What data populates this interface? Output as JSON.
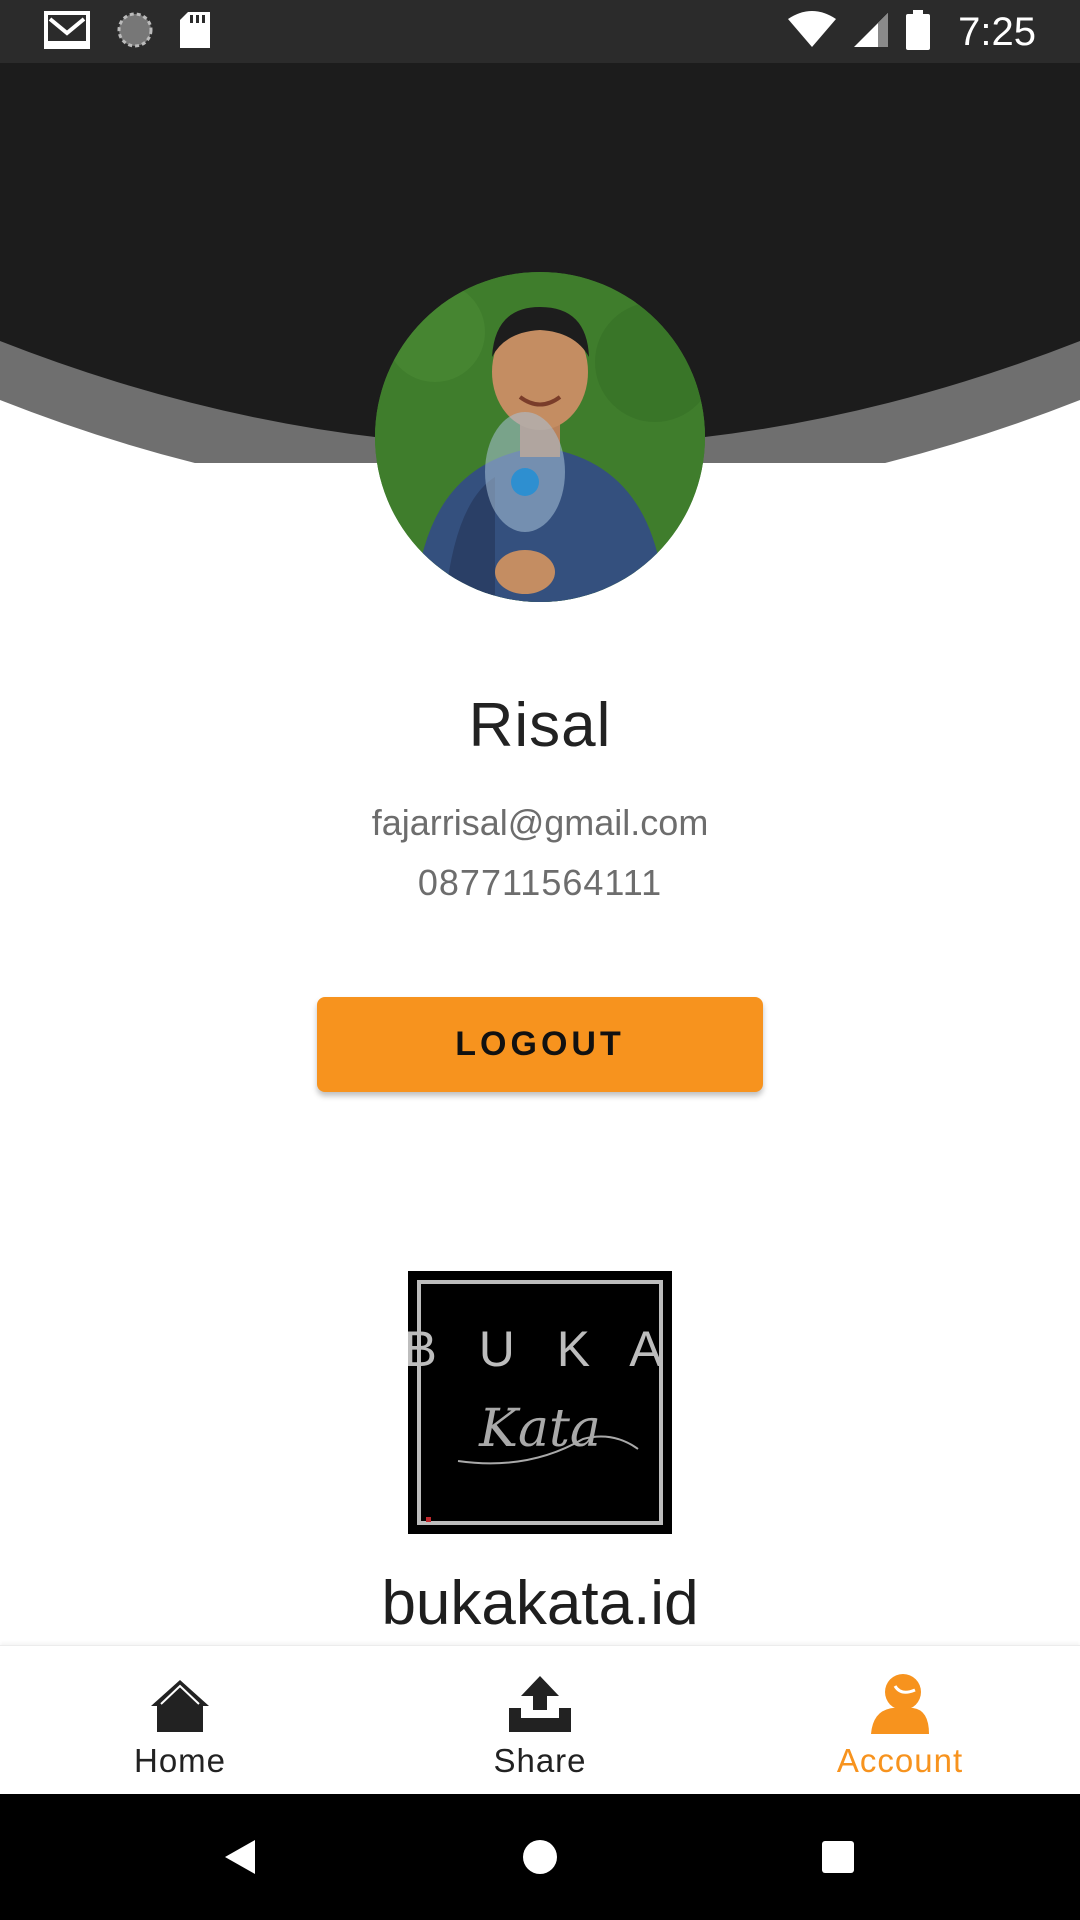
{
  "status_bar": {
    "time": "7:25",
    "left_icons": [
      "gmail-icon",
      "sync-icon",
      "sd-card-icon"
    ],
    "right_icons": [
      "wifi-icon",
      "cell-signal-icon",
      "battery-icon"
    ]
  },
  "profile": {
    "name": "Risal",
    "email": "fajarrisal@gmail.com",
    "phone": "087711564111",
    "logout_label": "LOGOUT"
  },
  "brand": {
    "logo_text_top": "B U K A",
    "logo_text_script": "Kata",
    "name": "bukakata.id"
  },
  "bottom_nav": {
    "items": [
      {
        "label": "Home",
        "icon": "home-icon",
        "active": false
      },
      {
        "label": "Share",
        "icon": "upload-icon",
        "active": false
      },
      {
        "label": "Account",
        "icon": "account-icon",
        "active": true
      }
    ]
  },
  "system_nav": {
    "buttons": [
      "back-icon",
      "home-circle-icon",
      "recents-icon"
    ]
  },
  "colors": {
    "accent": "#f7931e",
    "header_dark": "#1c1c1c",
    "header_grey": "#6f6f6f",
    "status_bar": "#2b2b2b"
  }
}
